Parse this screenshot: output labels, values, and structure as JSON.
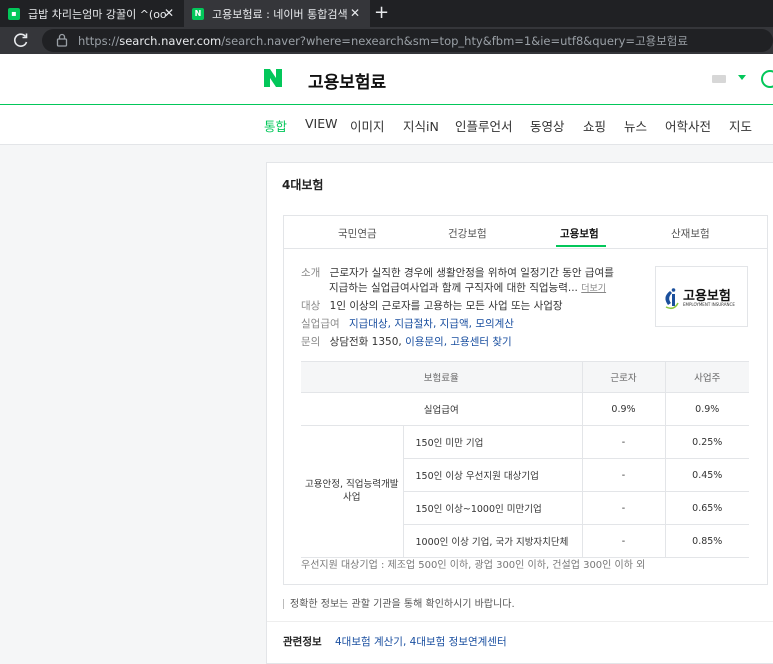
{
  "browser": {
    "tabs": [
      {
        "title": "급밥 차리는엄마 강꿀이 ^(oo)^(",
        "favicon": "blog"
      },
      {
        "title": "고용보험료 : 네이버 통합검색",
        "favicon": "N"
      }
    ],
    "url_scheme": "https://",
    "url_host": "search.naver.com",
    "url_path": "/search.naver?where=nexearch&sm=top_hty&fbm=1&ie=utf8&query=고용보험료"
  },
  "header": {
    "logo": "N",
    "query": "고용보험료"
  },
  "nav": [
    "통합",
    "VIEW",
    "이미지",
    "지식iN",
    "인플루언서",
    "동영상",
    "쇼핑",
    "뉴스",
    "어학사전",
    "지도"
  ],
  "card": {
    "title": "4대보험",
    "tabs": [
      "국민연금",
      "건강보험",
      "고용보험",
      "산재보험"
    ],
    "active_tab": "고용보험",
    "intro": {
      "label_intro": "소개",
      "intro_line1": "근로자가 실직한 경우에 생활안정을 위하여 일정기간 동안 급여를",
      "intro_line2": "지급하는 실업급여사업과 함께 구직자에 대한 직업능력...",
      "more": "더보기",
      "label_target": "대상",
      "target": "1인 이상의 근로자를 고용하는 모든 사업 또는 사업장",
      "label_benefit": "실업급여",
      "benefit_links": [
        "지급대상",
        "지급절차",
        "지급액",
        "모의계산"
      ],
      "label_contact": "문의",
      "contact_text": "상담전화 1350,",
      "contact_links": [
        "이용문의",
        "고용센터 찾기"
      ]
    },
    "logo": {
      "text": "고용보험",
      "sub": "EMPLOYMENT INSURANCE"
    },
    "table": {
      "headers": [
        "보험료율",
        "근로자",
        "사업주"
      ],
      "unemployment": {
        "label": "실업급여",
        "worker": "0.9%",
        "employer": "0.9%"
      },
      "group_label": "고용안정, 직업능력개발사업",
      "rows": [
        {
          "label": "150인 미만 기업",
          "worker": "-",
          "employer": "0.25%"
        },
        {
          "label": "150인 이상 우선지원 대상기업",
          "worker": "-",
          "employer": "0.45%"
        },
        {
          "label": "150인 이상~1000인 미만기업",
          "worker": "-",
          "employer": "0.65%"
        },
        {
          "label": "1000인 이상 기업, 국가 지방자치단체",
          "worker": "-",
          "employer": "0.85%"
        }
      ]
    },
    "note": "우선지원 대상기업 : 제조업 500인 이하, 광업 300인 이하, 건설업 300인 이하 외",
    "disclaimer": "정확한 정보는 관할 기관을 통해 확인하시기 바랍니다.",
    "related": {
      "label": "관련정보",
      "links": [
        "4대보험 계산기",
        "4대보험 정보연계센터"
      ]
    }
  },
  "colors": {
    "naver_green": "#03c75a",
    "link": "#1a4fa0"
  }
}
